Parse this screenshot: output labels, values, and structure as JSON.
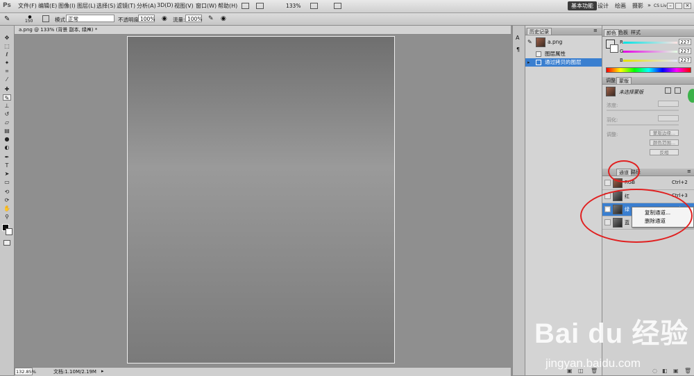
{
  "app": {
    "logo": "Ps"
  },
  "menubar": {
    "items": [
      "文件(F)",
      "编辑(E)",
      "图像(I)",
      "图层(L)",
      "选择(S)",
      "滤镜(T)",
      "分析(A)",
      "3D(D)",
      "视图(V)",
      "窗口(W)",
      "帮助(H)"
    ],
    "zoom": "133%",
    "workspaces": [
      "基本功能",
      "设计",
      "绘画",
      "摄影"
    ],
    "active_workspace": "基本功能",
    "more": "»",
    "cs_live": "CS Live"
  },
  "options": {
    "brush_size": "150",
    "mode_label": "模式:",
    "mode_value": "正常",
    "opacity_label": "不透明度:",
    "opacity_value": "100%",
    "flow_label": "流量:",
    "flow_value": "100%"
  },
  "document": {
    "tab_title": "a.png @ 133% (背景 副本, 绿/8) *",
    "zoom": "132.85%",
    "doc_info": "文档:1.10M/2.19M"
  },
  "history": {
    "tab": "历史记录",
    "snapshot": "a.png",
    "items": [
      "图层属性",
      "通过拷贝的图层"
    ],
    "selected_index": 1
  },
  "color": {
    "tabs": [
      "颜色",
      "色板",
      "样式"
    ],
    "r_label": "R",
    "g_label": "G",
    "b_label": "B",
    "r": "227",
    "g": "227",
    "b": "227"
  },
  "masks": {
    "tabs": [
      "调整",
      "蒙版"
    ],
    "title": "未选择蒙版",
    "density_label": "浓度:",
    "feather_label": "羽化:",
    "refine_label": "调整:",
    "buttons": [
      "蒙版边缘...",
      "颜色范围...",
      "反相"
    ]
  },
  "channels": {
    "tabs": [
      "通道",
      "路径"
    ],
    "rows": [
      {
        "name": "RGB",
        "key": "Ctrl+2"
      },
      {
        "name": "红",
        "key": "Ctrl+3"
      },
      {
        "name": "绿",
        "key": "Ctrl+4"
      },
      {
        "name": "蓝",
        "key": "Ctrl+5"
      }
    ],
    "selected_index": 2
  },
  "context_menu": {
    "items": [
      "复制通道...",
      "删除通道"
    ]
  },
  "watermark": {
    "brand": "Bai du 经验",
    "url": "jingyan.baidu.com"
  },
  "colors": {
    "highlight": "#3a7fd0",
    "annotation": "#e02020",
    "workspace_active": "#3b3b3b"
  }
}
